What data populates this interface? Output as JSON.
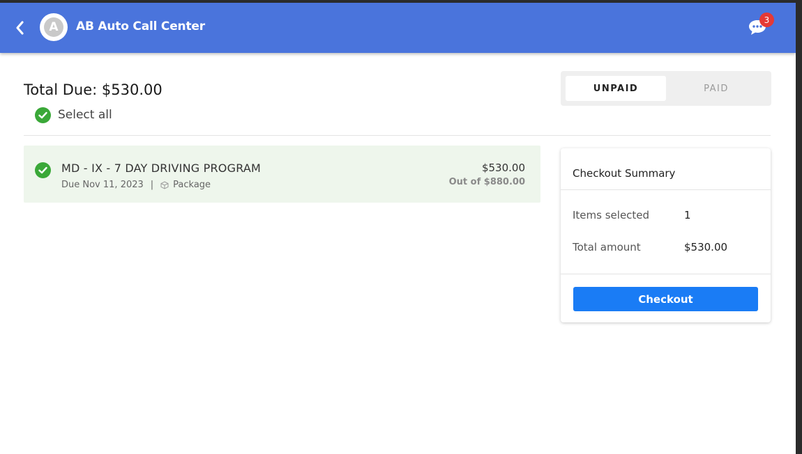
{
  "header": {
    "title": "AB Auto Call Center",
    "logo_letter": "A",
    "chat_badge_count": "3",
    "accent_color": "#4a74dc"
  },
  "totals": {
    "total_due": "Total Due: $530.00",
    "select_all_label": "Select all"
  },
  "tabs": [
    {
      "label": "UNPAID",
      "active": true
    },
    {
      "label": "PAID",
      "active": false
    }
  ],
  "items": [
    {
      "title": "MD - IX - 7 DAY DRIVING PROGRAM",
      "due": "Due Nov 11, 2023",
      "separator": "|",
      "type": "Package",
      "amount": "$530.00",
      "out_of": "Out of $880.00",
      "selected": true
    }
  ],
  "summary": {
    "title": "Checkout Summary",
    "items_selected_label": "Items selected",
    "items_selected_value": "1",
    "total_amount_label": "Total amount",
    "total_amount_value": "$530.00",
    "checkout_label": "Checkout"
  },
  "icons": {
    "back": "chevron-left-icon",
    "chat": "chat-bubble-icon",
    "check": "check-circle-icon",
    "package": "package-box-icon"
  }
}
